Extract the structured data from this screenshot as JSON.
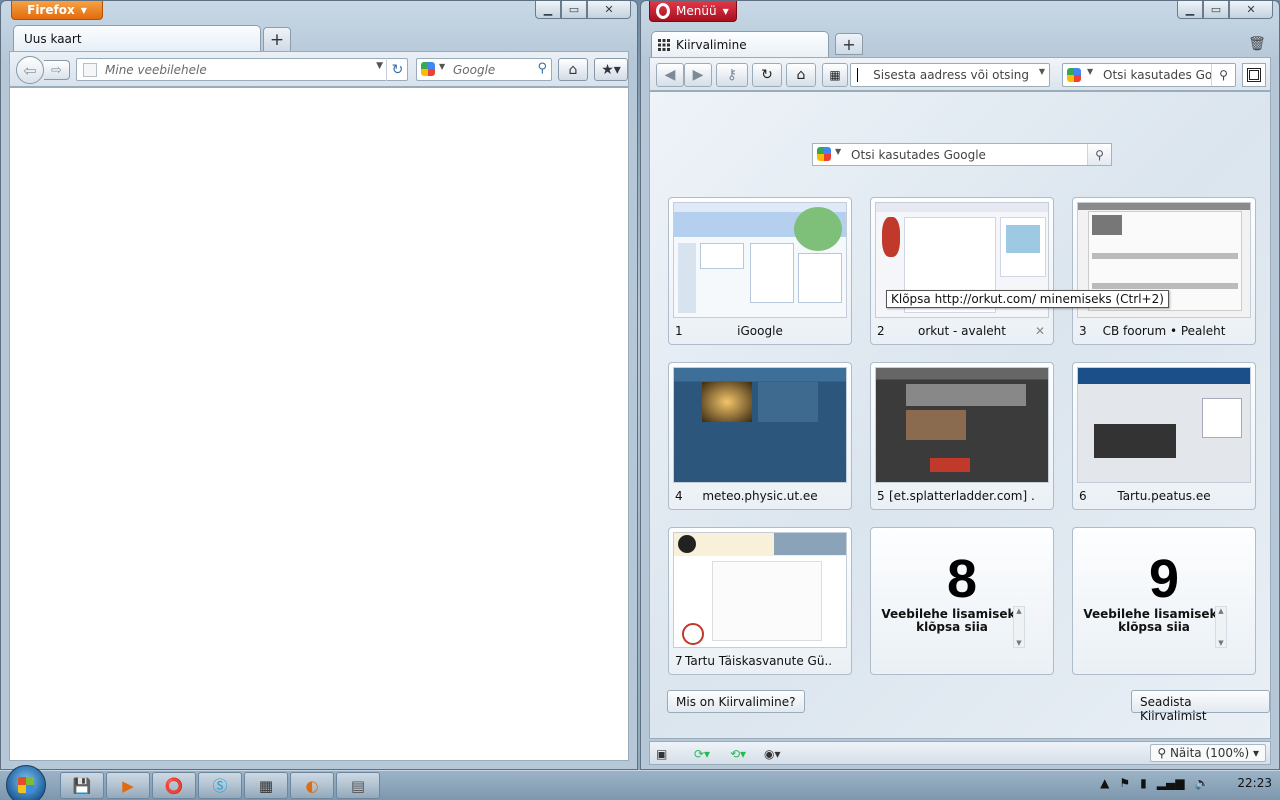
{
  "firefox": {
    "app_button": "Firefox",
    "tab_title": "Uus kaart",
    "url_placeholder": "Mine veebilehele",
    "search_placeholder": "Google"
  },
  "opera": {
    "menu_label": "Menüü",
    "tab_title": "Kiirvalimine",
    "address_placeholder": "Sisesta aadress või otsing",
    "toolbar_search_placeholder": "Otsi kasutades Goog",
    "speed_dial_search_placeholder": "Otsi kasutades Google",
    "tooltip": "Klõpsa http://orkut.com/ minemiseks (Ctrl+2)",
    "tiles": [
      {
        "num": "1",
        "title": "iGoogle"
      },
      {
        "num": "2",
        "title": "orkut - avaleht"
      },
      {
        "num": "3",
        "title": "CB foorum • Pealeht"
      },
      {
        "num": "4",
        "title": "meteo.physic.ut.ee"
      },
      {
        "num": "5",
        "title": "[et.splatterladder.com] ..."
      },
      {
        "num": "6",
        "title": "Tartu.peatus.ee"
      },
      {
        "num": "7",
        "title": "Tartu Täiskasvanute Gü..."
      },
      {
        "num": "8",
        "hint": "Veebilehe lisamiseks klõpsa siia"
      },
      {
        "num": "9",
        "hint": "Veebilehe lisamiseks klõpsa siia"
      }
    ],
    "help_button": "Mis on Kiirvalimine?",
    "settings_button": "Seadista Kiirvalimist",
    "zoom_label": "Näita (100%)"
  },
  "taskbar": {
    "clock": "22:23"
  },
  "icons": {
    "ff_back": "back-arrow-icon",
    "ff_forward": "forward-arrow-icon",
    "ff_reload": "reload-icon",
    "ff_home": "home-icon",
    "ff_bookmarks": "bookmarks-icon",
    "op_back": "back-arrow-icon",
    "op_forward": "forward-arrow-icon",
    "op_key": "key-icon",
    "op_reload": "reload-icon",
    "op_home": "home-icon",
    "op_speeddial": "speed-dial-icon",
    "op_qr": "qr-code-icon",
    "trash": "trash-icon"
  },
  "colors": {
    "firefox_orange": "#e26b0b",
    "opera_red": "#c0182a"
  }
}
